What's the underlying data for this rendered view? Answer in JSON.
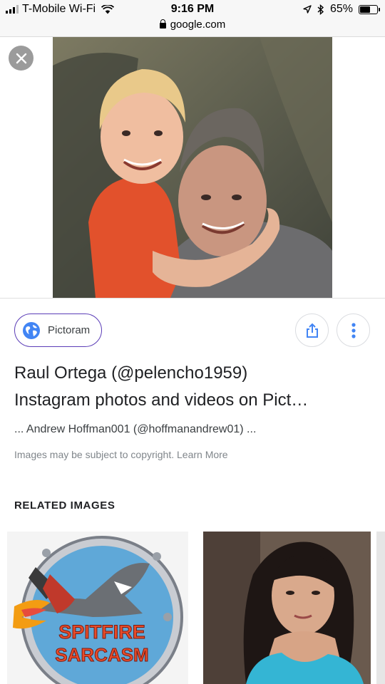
{
  "status_bar": {
    "carrier": "T-Mobile Wi-Fi",
    "time": "9:16 PM",
    "url": "google.com",
    "battery_percent": "65%",
    "battery_level": 0.65,
    "signal_bars": 3
  },
  "viewer": {
    "close_icon": "close-icon",
    "image_icon": "photo-man-and-boy"
  },
  "result": {
    "source_name": "Pictoram",
    "title_line1": "Raul Ortega (@pelencho1959)",
    "title_line2": "Instagram photos and videos on Pict…",
    "snippet": "... Andrew Hoffman001 (@hoffmanandrew01) ...",
    "copyright_notice": "Images may be subject to copyright. Learn More"
  },
  "related": {
    "heading": "RELATED IMAGES",
    "thumbnails": [
      {
        "icon": "spitfire-sarcasm-logo",
        "logo_text_1": "SPITFIRE",
        "logo_text_2": "SARCASM"
      },
      {
        "icon": "selfie-photo"
      },
      {
        "icon": "photo-partial"
      }
    ]
  },
  "colors": {
    "chip_border": "#5b3db7",
    "icon_blue": "#4285f4"
  }
}
